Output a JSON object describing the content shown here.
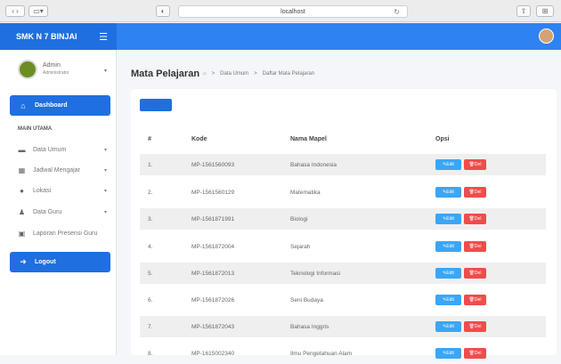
{
  "browser": {
    "url": "localhost",
    "reload": "↻"
  },
  "app": {
    "brand": "SMK N 7 BINJAI"
  },
  "sidebar": {
    "user": {
      "name": "Admin",
      "role": "Administrator"
    },
    "dashboard_label": "Dashboard",
    "section_label": "MAIN UTAMA",
    "items": [
      {
        "label": "Data Umum",
        "caret": "▾",
        "icon": "folder-icon"
      },
      {
        "label": "Jadwal Mengajar",
        "caret": "▾",
        "icon": "calendar-icon"
      },
      {
        "label": "Lokasi",
        "caret": "▾",
        "icon": "map-pin-icon"
      },
      {
        "label": "Data Guru",
        "caret": "▾",
        "icon": "user-icon"
      },
      {
        "label": "Laporan Presensi Guru",
        "caret": "",
        "icon": "report-icon"
      }
    ],
    "logout_label": "Logout"
  },
  "page": {
    "title": "Mata Pelajaran",
    "breadcrumb": [
      "Data Umum",
      "Daftar Mata Pelajaran"
    ],
    "add_label": "Tambah"
  },
  "table": {
    "headers": [
      "#",
      "Kode",
      "Nama Mapel",
      "Opsi"
    ],
    "edit_label": "Edit",
    "del_label": "Del",
    "rows": [
      [
        "1.",
        "MP-1561560093",
        "Bahasa Indonesia"
      ],
      [
        "2.",
        "MP-1561560129",
        "Matematika"
      ],
      [
        "3.",
        "MP-1561871991",
        "Biologi"
      ],
      [
        "4.",
        "MP-1561872004",
        "Sejarah"
      ],
      [
        "5.",
        "MP-1561872013",
        "Teknologi Informasi"
      ],
      [
        "6.",
        "MP-1561872026",
        "Seni Budaya"
      ],
      [
        "7.",
        "MP-1561872043",
        "Bahasa Inggris"
      ],
      [
        "8.",
        "MP-1615002340",
        "Ilmu Pengetahuan Alam"
      ]
    ]
  },
  "colors": {
    "primary": "#1f6fe0",
    "edit": "#3ba6f5",
    "delete": "#f24b4b"
  }
}
